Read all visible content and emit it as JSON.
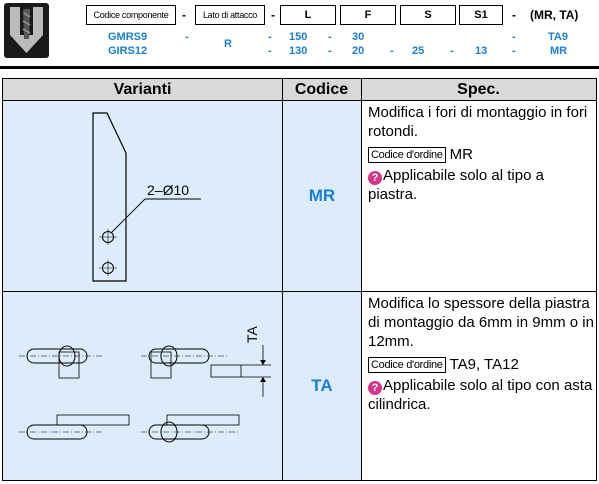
{
  "header": {
    "boxes": [
      "Codice componente",
      "Lato di attacco",
      "L",
      "F",
      "S",
      "S1"
    ],
    "suffix": "(MR, TA)",
    "separator": "-",
    "row1": {
      "code": "GMRS9",
      "sep1": "-",
      "lato": "R",
      "sep2": "-",
      "L": "150",
      "sep3": "-",
      "F": "30",
      "sep4": "",
      "S": "",
      "sep5": "",
      "S1": "",
      "sep6": "-",
      "opt": "TA9"
    },
    "row2": {
      "code": "GIRS12",
      "sep1": "",
      "lato": "",
      "sep2": "-",
      "L": "130",
      "sep3": "-",
      "F": "20",
      "sep4": "-",
      "S": "25",
      "sep5": "-",
      "S1": "13",
      "sep6": "-",
      "opt": "MR"
    }
  },
  "table": {
    "columns": [
      "Varianti",
      "Codice",
      "Spec."
    ],
    "rows": [
      {
        "code": "MR",
        "drawing_label": "2–Ø10",
        "spec_text": "Modifica i fori di montaggio in fori rotondi.",
        "order_tag": "Codice d'ordine",
        "order_value": "MR",
        "note": "Applicabile solo al tipo a piastra."
      },
      {
        "code": "TA",
        "drawing_label": "TA",
        "spec_text": "Modifica lo spessore della piastra di montaggio da 6mm in 9mm o in 12mm.",
        "order_tag": "Codice d'ordine",
        "order_value": "TA9, TA12",
        "note": "Applicabile solo al tipo con asta cilindrica."
      }
    ]
  },
  "colors": {
    "accent": "#1a7fd0",
    "cell_bg": "#dcecfb",
    "header_bg": "#d9d9d9",
    "info": "#d6338a"
  },
  "icons": {
    "logo": "drill-bit-icon",
    "note": "info-icon"
  }
}
